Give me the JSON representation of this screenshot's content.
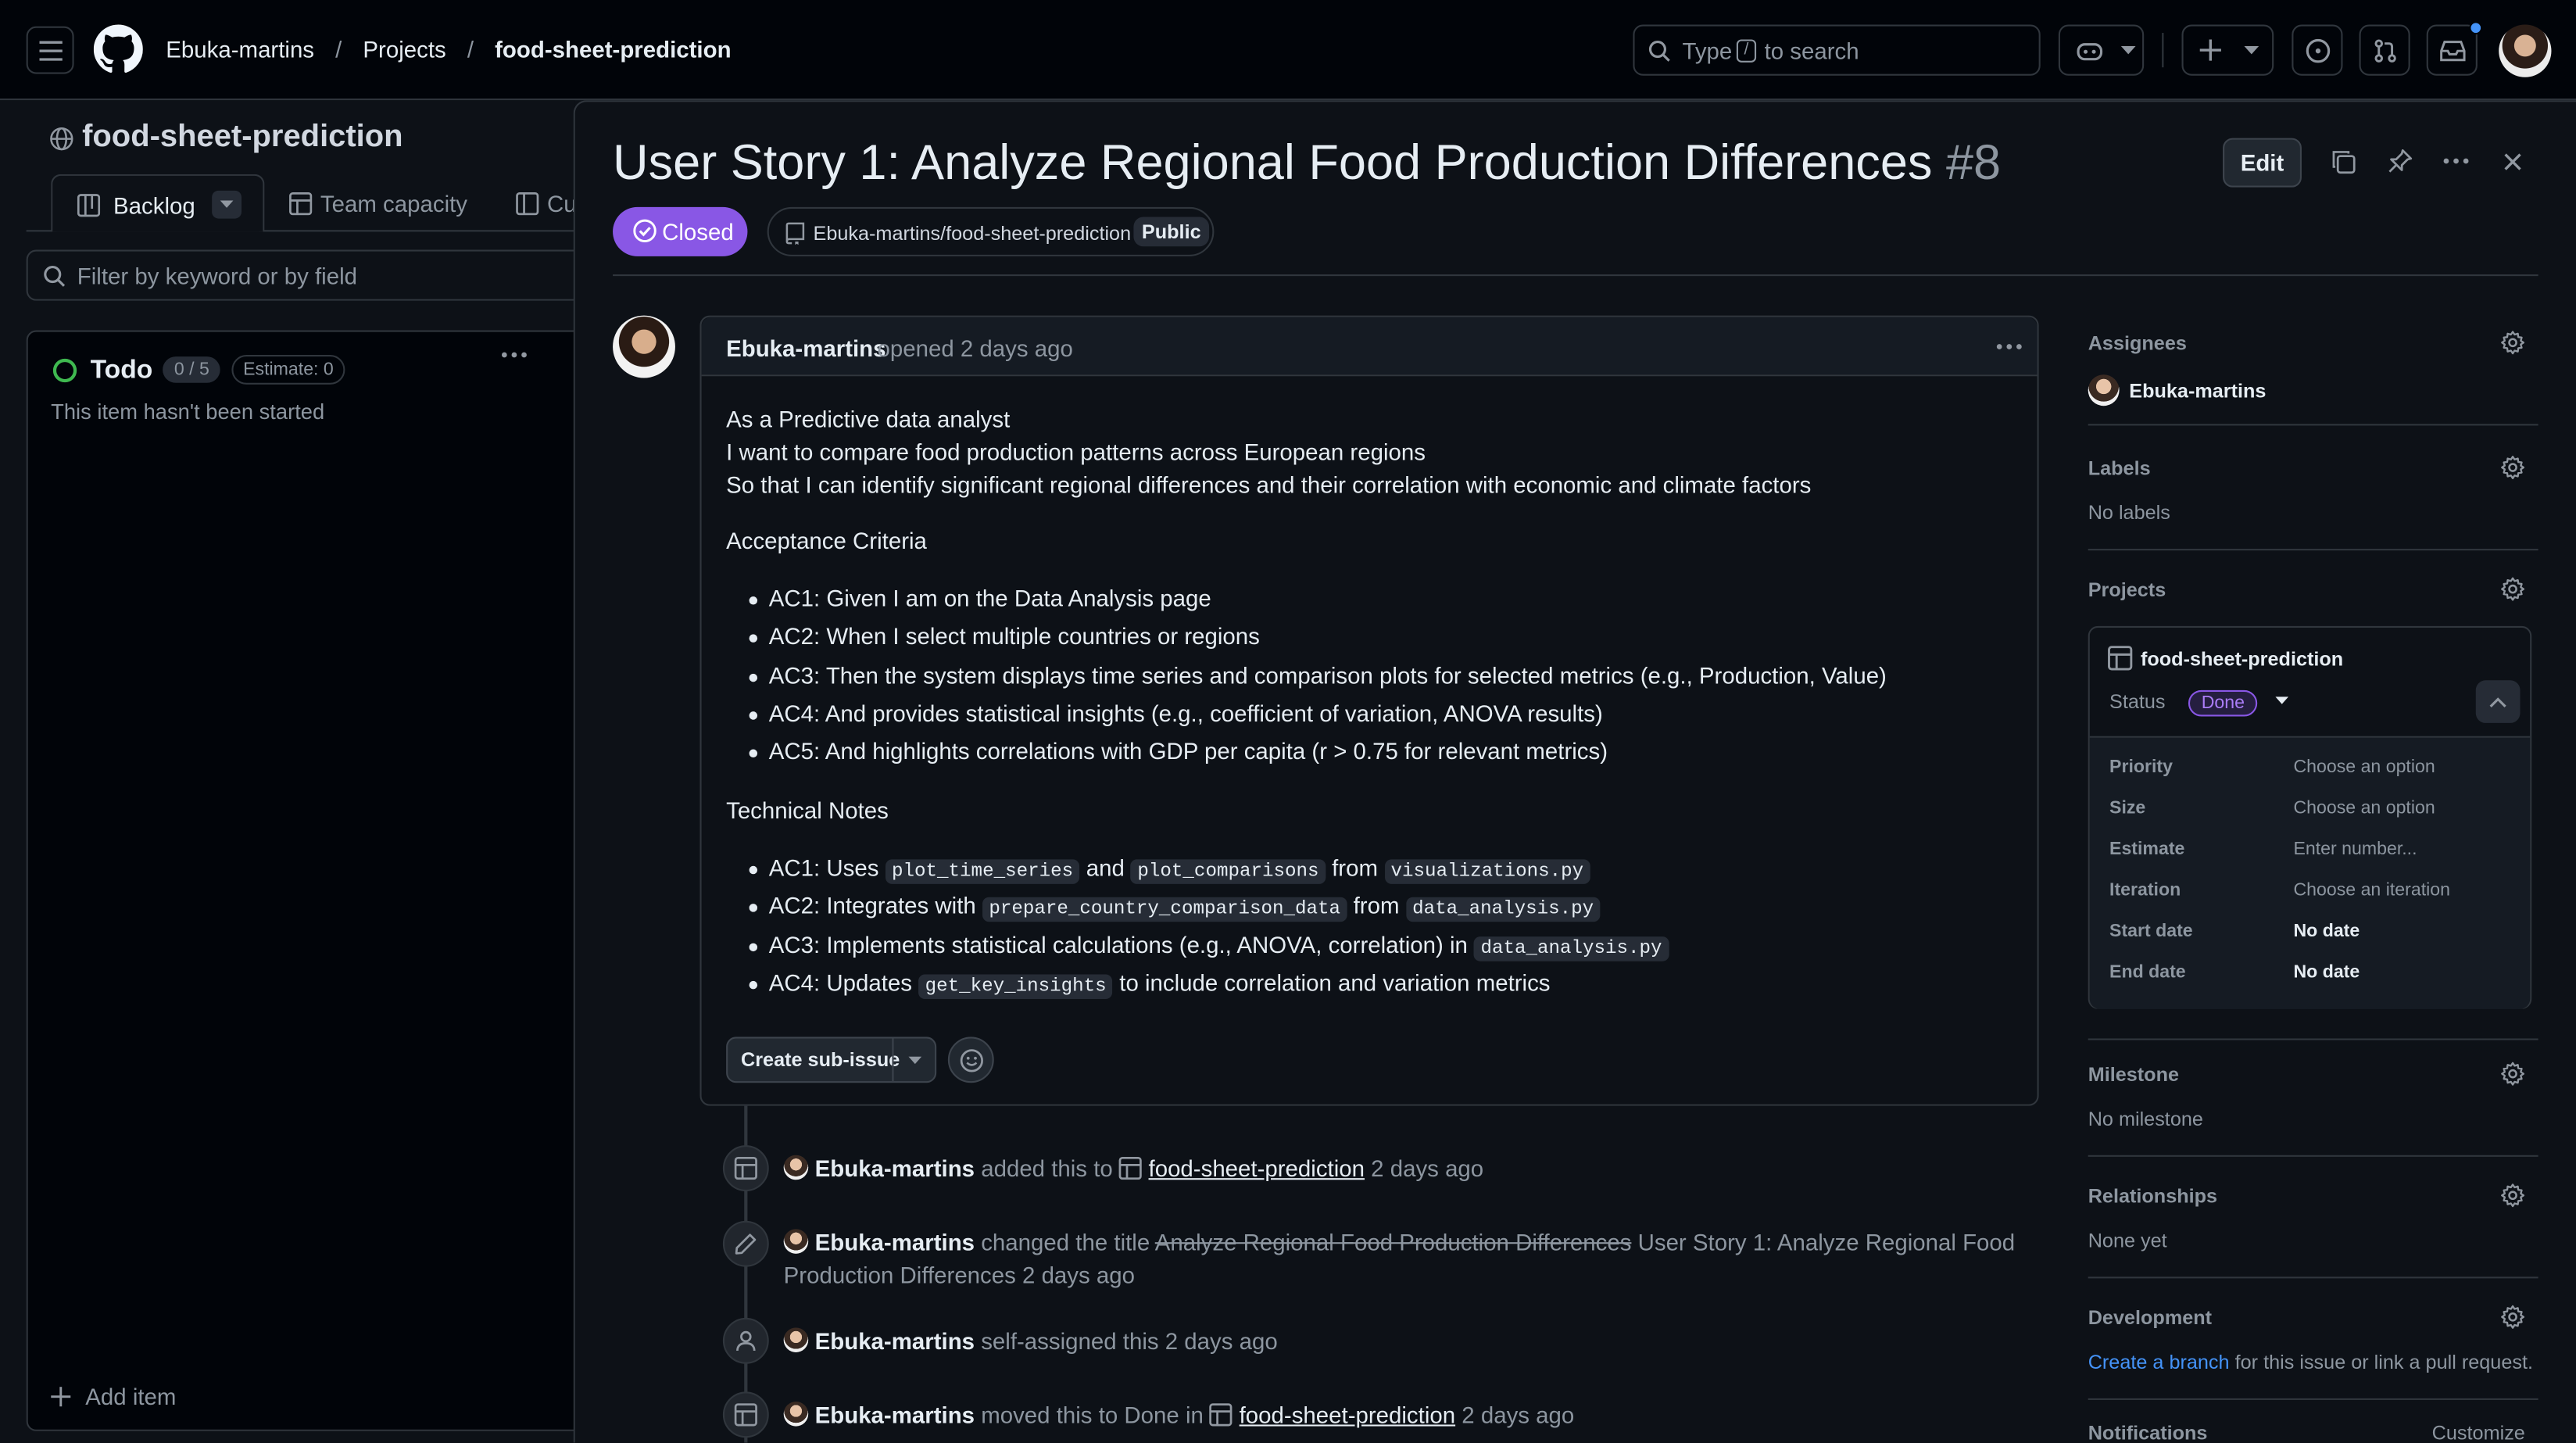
{
  "header": {
    "owner": "Ebuka-martins",
    "projects": "Projects",
    "repo": "food-sheet-prediction",
    "search_prefix": "Type",
    "search_key": "/",
    "search_suffix": "to search"
  },
  "project_panel": {
    "title": "food-sheet-prediction",
    "tabs": [
      {
        "label": "Backlog"
      },
      {
        "label": "Team capacity"
      },
      {
        "label": "Cu"
      }
    ],
    "filter_placeholder": "Filter by keyword or by field",
    "column": {
      "name": "Todo",
      "count": "0 / 5",
      "estimate": "Estimate: 0",
      "empty_text": "This item hasn't been started",
      "add_item": "Add item"
    }
  },
  "issue": {
    "title": "User Story 1: Analyze Regional Food Production Differences",
    "number": "#8",
    "edit_label": "Edit",
    "state": "Closed",
    "repo_ref": "Ebuka-martins/food-sheet-prediction",
    "visibility": "Public",
    "author": "Ebuka-martins",
    "opened": "opened 2 days ago",
    "story": [
      "As a Predictive data analyst",
      "I want to compare food production patterns across European regions",
      "So that I can identify significant regional differences and their correlation with economic and climate factors"
    ],
    "acceptance_heading": "Acceptance Criteria",
    "acceptance": [
      "AC1: Given I am on the Data Analysis page",
      "AC2: When I select multiple countries or regions",
      "AC3: Then the system displays time series and comparison plots for selected metrics (e.g., Production, Value)",
      "AC4: And provides statistical insights (e.g., coefficient of variation, ANOVA results)",
      "AC5: And highlights correlations with GDP per capita (r > 0.75 for relevant metrics)"
    ],
    "tech_heading": "Technical Notes",
    "tech": {
      "n1_a": "AC1: Uses",
      "n1_c1": "plot_time_series",
      "n1_b": "and",
      "n1_c2": "plot_comparisons",
      "n1_c": "from",
      "n1_c3": "visualizations.py",
      "n2_a": "AC2: Integrates with",
      "n2_c1": "prepare_country_comparison_data",
      "n2_b": "from",
      "n2_c2": "data_analysis.py",
      "n3_a": "AC3: Implements statistical calculations (e.g., ANOVA, correlation) in",
      "n3_c1": "data_analysis.py",
      "n4_a": "AC4: Updates",
      "n4_c1": "get_key_insights",
      "n4_b": "to include correlation and variation metrics"
    },
    "create_sub_issue": "Create sub-issue"
  },
  "timeline": {
    "e1_user": "Ebuka-martins",
    "e1_text": "added this to",
    "e1_link": "food-sheet-prediction",
    "e1_time": "2 days ago",
    "e2_user": "Ebuka-martins",
    "e2_text": "changed the title",
    "e2_old": "Analyze Regional Food Production Differences",
    "e2_new_line1": "User Story 1: Analyze Regional Food",
    "e2_new_line2": "Production Differences",
    "e2_time": "2 days ago",
    "e3_user": "Ebuka-martins",
    "e3_text": "self-assigned this 2 days ago",
    "e4_user": "Ebuka-martins",
    "e4_text": "moved this to Done in",
    "e4_link": "food-sheet-prediction",
    "e4_time": "2 days ago"
  },
  "sidebar": {
    "assignees_h": "Assignees",
    "assignee": "Ebuka-martins",
    "labels_h": "Labels",
    "labels_v": "No labels",
    "projects_h": "Projects",
    "project_name": "food-sheet-prediction",
    "status_k": "Status",
    "status_v": "Done",
    "fields": [
      {
        "k": "Priority",
        "v": "Choose an option"
      },
      {
        "k": "Size",
        "v": "Choose an option"
      },
      {
        "k": "Estimate",
        "v": "Enter number..."
      },
      {
        "k": "Iteration",
        "v": "Choose an iteration"
      },
      {
        "k": "Start date",
        "v": "No date"
      },
      {
        "k": "End date",
        "v": "No date"
      }
    ],
    "milestone_h": "Milestone",
    "milestone_v": "No milestone",
    "relationships_h": "Relationships",
    "relationships_v": "None yet",
    "development_h": "Development",
    "development_link": "Create a branch",
    "development_rest": "for this issue or link a pull request.",
    "notifications_h": "Notifications",
    "notifications_action": "Customize"
  },
  "colors": {
    "closed": "#8957e5",
    "done_badge": "#8957e5",
    "link": "#4493f8",
    "bg": "#0d1117",
    "border": "#30363d"
  }
}
